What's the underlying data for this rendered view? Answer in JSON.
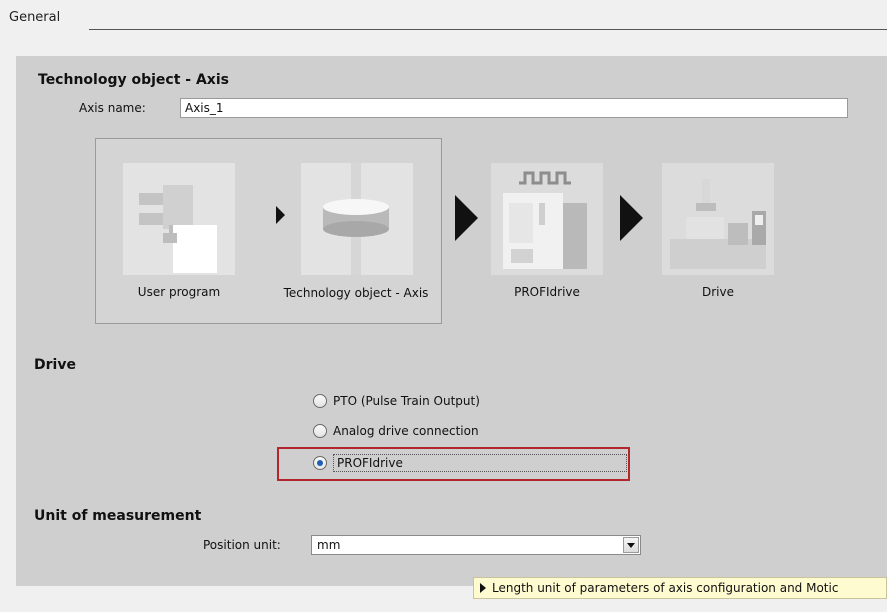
{
  "general": {
    "title": "General"
  },
  "technology": {
    "heading": "Technology object - Axis",
    "axis_name_label": "Axis name:",
    "axis_name_value": "Axis_1",
    "flow": [
      {
        "caption": "User program",
        "icon": "user-program-icon"
      },
      {
        "caption": "Technology object - Axis",
        "icon": "technology-object-axis-icon"
      },
      {
        "caption": "PROFIdrive",
        "icon": "profidrive-icon"
      },
      {
        "caption": "Drive",
        "icon": "drive-icon"
      }
    ]
  },
  "drive": {
    "heading": "Drive",
    "options": [
      {
        "label": "PTO (Pulse Train Output)",
        "checked": false
      },
      {
        "label": "Analog drive connection",
        "checked": false
      },
      {
        "label": "PROFIdrive",
        "checked": true
      }
    ]
  },
  "unit": {
    "heading": "Unit of measurement",
    "position_label": "Position unit:",
    "position_value": "mm"
  },
  "tooltip": {
    "text": "Length unit of parameters of axis configuration and Motic"
  },
  "colors": {
    "panel": "#cfcfcf",
    "highlight": "#b3262d",
    "radio_selected": "#1e5fb3",
    "tooltip_bg": "#fffbd1"
  }
}
